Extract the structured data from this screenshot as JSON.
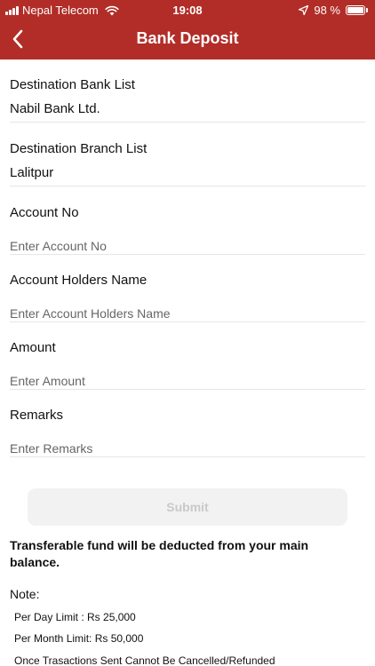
{
  "status_bar": {
    "carrier": "Nepal Telecom",
    "time": "19:08",
    "battery": "98 %",
    "battery_level": 0.98
  },
  "nav": {
    "title": "Bank Deposit",
    "back_icon": "chevron-left-icon"
  },
  "form": {
    "destination_bank": {
      "label": "Destination Bank List",
      "value": "Nabil Bank Ltd."
    },
    "destination_branch": {
      "label": "Destination Branch List",
      "value": "Lalitpur"
    },
    "account_no": {
      "label": "Account No",
      "placeholder": "Enter Account No"
    },
    "account_holder": {
      "label": "Account Holders Name",
      "placeholder": "Enter Account Holders Name"
    },
    "amount": {
      "label": "Amount",
      "placeholder": "Enter Amount"
    },
    "remarks": {
      "label": "Remarks",
      "placeholder": "Enter Remarks"
    },
    "submit_label": "Submit"
  },
  "notice": {
    "deduct_text": "Transferable fund will be deducted from your main balance.",
    "note_title": "Note:",
    "lines": [
      "Per Day Limit : Rs 25,000",
      "Per Month Limit: Rs 50,000",
      "Once Trasactions Sent Cannot Be Cancelled/Refunded"
    ]
  },
  "colors": {
    "header": "#b22d28",
    "submit_bg": "#f2f2f2",
    "submit_text": "#c9c9c9"
  }
}
